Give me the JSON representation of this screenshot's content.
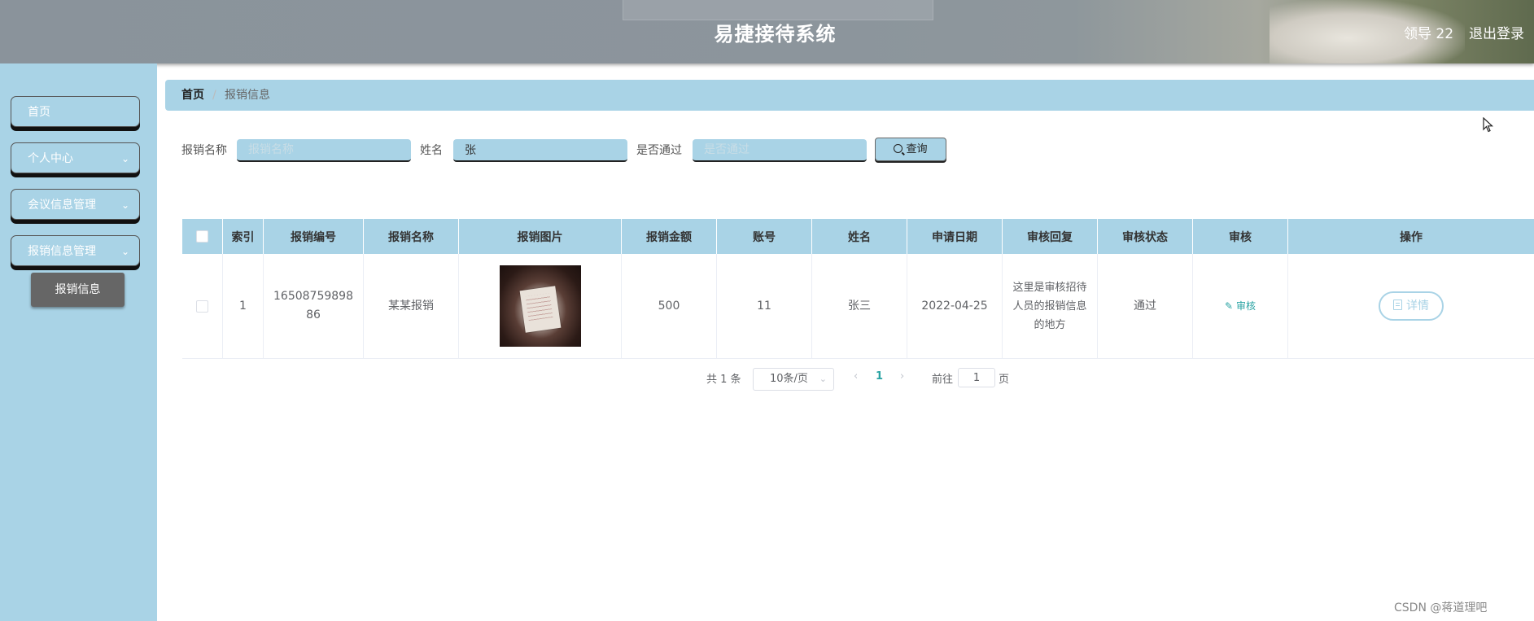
{
  "header": {
    "title": "易捷接待系统",
    "user": "领导 22",
    "logout": "退出登录"
  },
  "sidebar": {
    "items": [
      {
        "label": "首页",
        "has_children": false
      },
      {
        "label": "个人中心",
        "has_children": true
      },
      {
        "label": "会议信息管理",
        "has_children": true
      },
      {
        "label": "报销信息管理",
        "has_children": true
      }
    ],
    "active_sub": "报销信息"
  },
  "breadcrumb": {
    "home": "首页",
    "separator": "/",
    "current": "报销信息"
  },
  "search": {
    "name_label": "报销名称",
    "name_placeholder": "报销名称",
    "name_value": "",
    "person_label": "姓名",
    "person_value": "张",
    "passed_label": "是否通过",
    "passed_placeholder": "是否通过",
    "passed_value": "",
    "query_button": "查询"
  },
  "table": {
    "columns": [
      "索引",
      "报销编号",
      "报销名称",
      "报销图片",
      "报销金额",
      "账号",
      "姓名",
      "申请日期",
      "审核回复",
      "审核状态",
      "审核",
      "操作"
    ],
    "rows": [
      {
        "index": "1",
        "code": "1650875989886",
        "name": "某某报销",
        "amount": "500",
        "account": "11",
        "person": "张三",
        "date": "2022-04-25",
        "reply": "这里是审核招待人员的报销信息的地方",
        "status": "通过",
        "audit_label": "审核",
        "detail_label": "详情"
      }
    ]
  },
  "pagination": {
    "total": "共 1 条",
    "page_size": "10条/页",
    "prev": "‹",
    "current_page": "1",
    "next": "›",
    "goto": "前往",
    "goto_value": "1",
    "page_unit": "页"
  },
  "watermark": "CSDN @蒋道理吧",
  "colors": {
    "accent": "#a9d3e6",
    "link": "#29a3a3",
    "active_sub": "#666666"
  }
}
